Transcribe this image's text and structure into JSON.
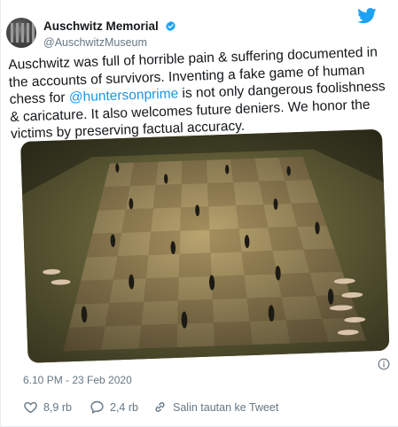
{
  "account": {
    "display_name": "Auschwitz Memorial",
    "handle": "@AuschwitzMuseum",
    "verified": true
  },
  "icons": {
    "bird": "twitter-bird-icon",
    "verified": "verified-badge-icon",
    "info": "info-icon",
    "like": "heart-icon",
    "reply": "reply-icon",
    "share": "share-link-icon"
  },
  "tweet": {
    "text_before": "Auschwitz was full of horrible pain & suffering documented in the accounts of survivors. Inventing a fake game of human chess for ",
    "mention": "@huntersonprime",
    "text_after": " is not only dangerous foolishness & caricature. It also welcomes future deniers. We honor the victims by preserving factual accuracy.",
    "timestamp": "6.10 PM - 23 Feb 2020"
  },
  "actions": {
    "likes": "8,9 rb",
    "replies": "2,4 rb",
    "share_label": "Salin tautan ke Tweet"
  },
  "colors": {
    "brand_blue": "#1da1f2",
    "mention_blue": "#1b95e0",
    "secondary_text": "#657786",
    "primary_text": "#14171a"
  }
}
